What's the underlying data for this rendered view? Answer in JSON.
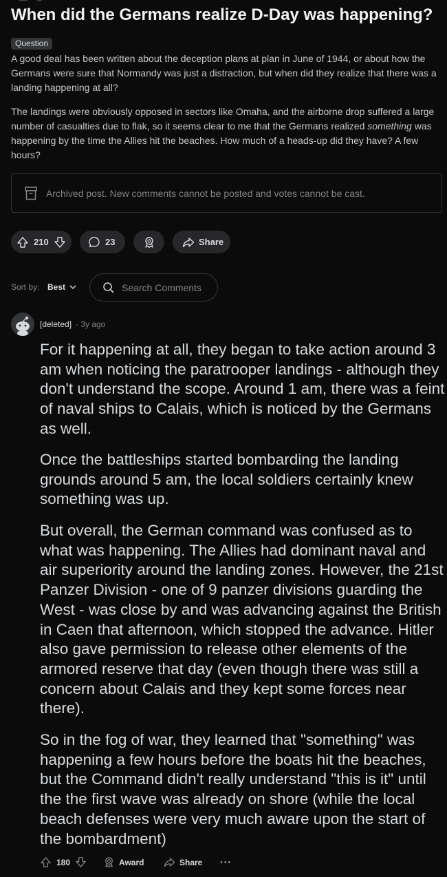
{
  "post": {
    "title": "When did the Germans realize D-Day was happening?",
    "flair": "Question",
    "body": [
      "A good deal has been written about the deception plans at plan in June of 1944, or about how the Germans were sure that Normandy was just a distraction, but when did they realize that there was a landing happening at all?",
      {
        "before": "The landings were obviously opposed in sectors like Omaha, and the airborne drop suffered a large number of casualties due to flak, so it seems clear to me that the Germans realized ",
        "emphasis": "something",
        "after": " was happening by the time the Allies hit the beaches. How much of a heads-up did they have? A few hours?"
      }
    ],
    "archived_notice": "Archived post. New comments cannot be posted and votes cannot be cast.",
    "votes": "210",
    "comments": "23",
    "share_label": "Share"
  },
  "sort": {
    "label": "Sort by:",
    "value": "Best"
  },
  "search": {
    "placeholder": "Search Comments"
  },
  "comment": {
    "author": "[deleted]",
    "time": "· 3y ago",
    "paragraphs": [
      "For it happening at all, they began to take action around 3 am when noticing the paratrooper landings - although they don't understand the scope. Around 1 am, there was a feint of naval ships to Calais, which is noticed by the Germans as well.",
      "Once the battleships started bombarding the landing grounds around 5 am, the local soldiers certainly knew something was up.",
      "But overall, the German command was confused as to what was happening. The Allies had dominant naval and air superiority around the landing zones. However, the 21st Panzer Division - one of 9 panzer divisions guarding the West - was close by and was advancing against the British in Caen that afternoon, which stopped the advance. Hitler also gave permission to release other elements of the armored reserve that day (even though there was still a concern about Calais and they kept some forces near there).",
      "So in the fog of war, they learned that \"something\" was happening a few hours before the boats hit the beaches, but the Command didn't really understand \"this is it\" until the the first wave was already on shore (while the local beach defenses were very much aware upon the start of the bombardment)"
    ],
    "votes": "180",
    "award_label": "Award",
    "share_label": "Share",
    "more_label": "···"
  },
  "colors": {
    "background": "#0b0b0c",
    "pill": "#272729",
    "border": "#343536",
    "muted": "#818384",
    "text": "#d7dadc"
  },
  "icons": [
    "upvote-icon",
    "downvote-icon",
    "comment-icon",
    "award-icon",
    "share-icon",
    "archive-icon",
    "search-icon",
    "chevron-down-icon",
    "avatar-icon",
    "more-icon"
  ]
}
